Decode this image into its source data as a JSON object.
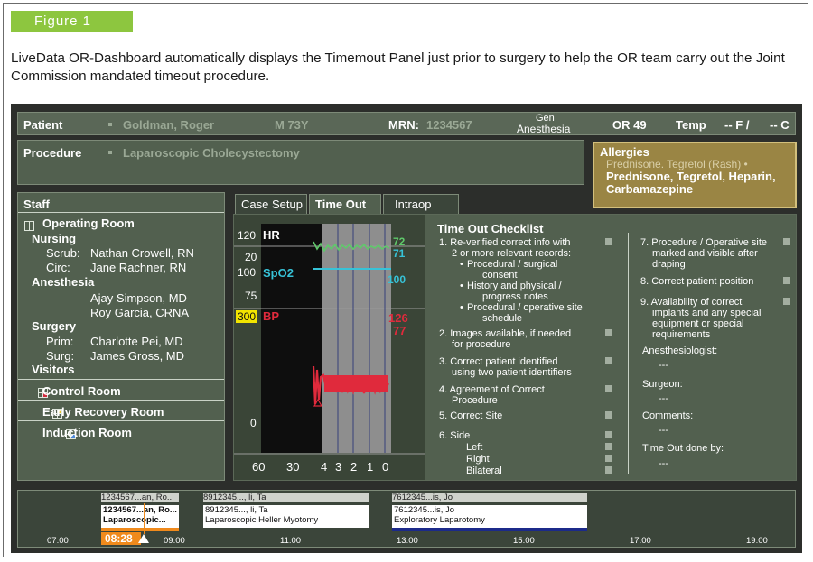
{
  "figure": {
    "tag": "Figure 1",
    "caption": "LiveData OR-Dashboard automatically displays the Timemout Panel just prior to surgery to help the OR team carry out the Joint Commission mandated timeout procedure."
  },
  "header": {
    "patient_label": "Patient",
    "patient_name": "Goldman, Roger",
    "sex_age": "M  73Y",
    "mrn_label": "MRN:",
    "mrn_value": "1234567",
    "anesthesia_line1": "Gen",
    "anesthesia_line2": "Anesthesia",
    "or_room": "OR 49",
    "temp_label": "Temp",
    "temp_f": "-- F /",
    "temp_c": "-- C"
  },
  "procedure": {
    "label": "Procedure",
    "value": "Laparoscopic Cholecystectomy"
  },
  "allergies": {
    "title": "Allergies",
    "strike_line": "Prednisone. Tegretol (Rash) •",
    "line1": "Prednisone, Tegretol, Heparin,",
    "line2": "Carbamazepine"
  },
  "staff": {
    "title": "Staff",
    "operating_room": "Operating Room",
    "nursing": "Nursing",
    "scrub_role": "Scrub:",
    "scrub_name": "Nathan Crowell, RN",
    "circ_role": "Circ:",
    "circ_name": "Jane Rachner, RN",
    "anesthesia": "Anesthesia",
    "anes1": "Ajay Simpson, MD",
    "anes2": "Roy Garcia, CRNA",
    "surgery": "Surgery",
    "prim_role": "Prim:",
    "prim_name": "Charlotte Pei, MD",
    "surg_role": "Surg:",
    "surg_name": "James Gross, MD",
    "visitors": "Visitors",
    "control_room": "Control Room",
    "early_recovery": "Early Recovery Room",
    "induction": "Induction Room"
  },
  "tabs": [
    "Case Setup",
    "Time Out",
    "Intraop"
  ],
  "vitals": {
    "hr_label": "HR",
    "spo2_label": "SpO2",
    "bp_label": "BP",
    "y_120": "120",
    "y_20": "20",
    "y_100": "100",
    "y_75": "75",
    "y_300": "300",
    "y_0": "0",
    "hr_val1": "72",
    "hr_val2": "71",
    "spo2_val": "100",
    "bp_sys": "126",
    "bp_dia": "77",
    "x_ticks": [
      "60",
      "30",
      "4",
      "3",
      "2",
      "1",
      "0"
    ],
    "colors": {
      "hr": "#5fc86a",
      "spo2": "#37c3d8",
      "bp": "#e02a3c",
      "bp_tag": "#f2e400"
    }
  },
  "checklist": {
    "title": "Time Out Checklist",
    "items_left": {
      "i1a": "1. Re-verified correct info with",
      "i1b": "2 or more relevant records:",
      "s1a": "Procedural / surgical",
      "s1b": "consent",
      "s2a": "History and physical /",
      "s2b": "progress notes",
      "s3a": "Procedural / operative site",
      "s3b": "schedule",
      "i2a": "2. Images available, if needed",
      "i2b": "for procedure",
      "i3a": "3. Correct patient identified",
      "i3b": "using two patient identifiers",
      "i4a": "4. Agreement of Correct",
      "i4b": "Procedure",
      "i5": "5. Correct Site",
      "i6": "6. Side",
      "left": "Left",
      "right": "Right",
      "bilateral": "Bilateral"
    },
    "items_right": {
      "i7a": "7. Procedure / Operative site",
      "i7b": "marked and visible after",
      "i7c": "draping",
      "i8": "8. Correct patient position",
      "i9a": "9. Availability of correct",
      "i9b": "implants and any special",
      "i9c": "equipment or special",
      "i9d": "requirements",
      "anes_label": "Anesthesiologist:",
      "surgeon_label": "Surgeon:",
      "comments_label": "Comments:",
      "done_label": "Time Out done by:",
      "blank": "---"
    }
  },
  "timeline": {
    "case1_top": "1234567...an, Ro...",
    "case1_l1": "1234567...an, Ro...",
    "case1_l2": "Laparoscopic...",
    "case2_top": "8912345..., li, Ta",
    "case2_l1": "8912345..., li, Ta",
    "case2_l2": "Laparoscopic Heller Myotomy",
    "case3_top": "7612345...is, Jo",
    "case3_l1": "7612345...is, Jo",
    "case3_l2": "Exploratory Laparotomy",
    "current_time": "08:28",
    "ticks": [
      "07:00",
      "09:00",
      "11:00",
      "13:00",
      "15:00",
      "17:00",
      "19:00"
    ]
  }
}
